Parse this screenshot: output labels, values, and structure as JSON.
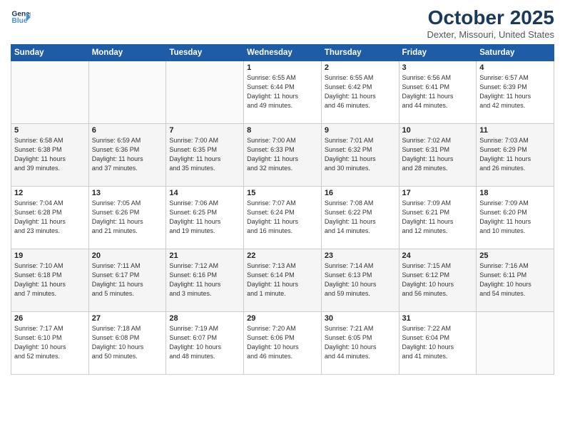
{
  "logo": {
    "line1": "General",
    "line2": "Blue"
  },
  "title": "October 2025",
  "location": "Dexter, Missouri, United States",
  "weekdays": [
    "Sunday",
    "Monday",
    "Tuesday",
    "Wednesday",
    "Thursday",
    "Friday",
    "Saturday"
  ],
  "weeks": [
    [
      {
        "num": "",
        "info": ""
      },
      {
        "num": "",
        "info": ""
      },
      {
        "num": "",
        "info": ""
      },
      {
        "num": "1",
        "info": "Sunrise: 6:55 AM\nSunset: 6:44 PM\nDaylight: 11 hours\nand 49 minutes."
      },
      {
        "num": "2",
        "info": "Sunrise: 6:55 AM\nSunset: 6:42 PM\nDaylight: 11 hours\nand 46 minutes."
      },
      {
        "num": "3",
        "info": "Sunrise: 6:56 AM\nSunset: 6:41 PM\nDaylight: 11 hours\nand 44 minutes."
      },
      {
        "num": "4",
        "info": "Sunrise: 6:57 AM\nSunset: 6:39 PM\nDaylight: 11 hours\nand 42 minutes."
      }
    ],
    [
      {
        "num": "5",
        "info": "Sunrise: 6:58 AM\nSunset: 6:38 PM\nDaylight: 11 hours\nand 39 minutes."
      },
      {
        "num": "6",
        "info": "Sunrise: 6:59 AM\nSunset: 6:36 PM\nDaylight: 11 hours\nand 37 minutes."
      },
      {
        "num": "7",
        "info": "Sunrise: 7:00 AM\nSunset: 6:35 PM\nDaylight: 11 hours\nand 35 minutes."
      },
      {
        "num": "8",
        "info": "Sunrise: 7:00 AM\nSunset: 6:33 PM\nDaylight: 11 hours\nand 32 minutes."
      },
      {
        "num": "9",
        "info": "Sunrise: 7:01 AM\nSunset: 6:32 PM\nDaylight: 11 hours\nand 30 minutes."
      },
      {
        "num": "10",
        "info": "Sunrise: 7:02 AM\nSunset: 6:31 PM\nDaylight: 11 hours\nand 28 minutes."
      },
      {
        "num": "11",
        "info": "Sunrise: 7:03 AM\nSunset: 6:29 PM\nDaylight: 11 hours\nand 26 minutes."
      }
    ],
    [
      {
        "num": "12",
        "info": "Sunrise: 7:04 AM\nSunset: 6:28 PM\nDaylight: 11 hours\nand 23 minutes."
      },
      {
        "num": "13",
        "info": "Sunrise: 7:05 AM\nSunset: 6:26 PM\nDaylight: 11 hours\nand 21 minutes."
      },
      {
        "num": "14",
        "info": "Sunrise: 7:06 AM\nSunset: 6:25 PM\nDaylight: 11 hours\nand 19 minutes."
      },
      {
        "num": "15",
        "info": "Sunrise: 7:07 AM\nSunset: 6:24 PM\nDaylight: 11 hours\nand 16 minutes."
      },
      {
        "num": "16",
        "info": "Sunrise: 7:08 AM\nSunset: 6:22 PM\nDaylight: 11 hours\nand 14 minutes."
      },
      {
        "num": "17",
        "info": "Sunrise: 7:09 AM\nSunset: 6:21 PM\nDaylight: 11 hours\nand 12 minutes."
      },
      {
        "num": "18",
        "info": "Sunrise: 7:09 AM\nSunset: 6:20 PM\nDaylight: 11 hours\nand 10 minutes."
      }
    ],
    [
      {
        "num": "19",
        "info": "Sunrise: 7:10 AM\nSunset: 6:18 PM\nDaylight: 11 hours\nand 7 minutes."
      },
      {
        "num": "20",
        "info": "Sunrise: 7:11 AM\nSunset: 6:17 PM\nDaylight: 11 hours\nand 5 minutes."
      },
      {
        "num": "21",
        "info": "Sunrise: 7:12 AM\nSunset: 6:16 PM\nDaylight: 11 hours\nand 3 minutes."
      },
      {
        "num": "22",
        "info": "Sunrise: 7:13 AM\nSunset: 6:14 PM\nDaylight: 11 hours\nand 1 minute."
      },
      {
        "num": "23",
        "info": "Sunrise: 7:14 AM\nSunset: 6:13 PM\nDaylight: 10 hours\nand 59 minutes."
      },
      {
        "num": "24",
        "info": "Sunrise: 7:15 AM\nSunset: 6:12 PM\nDaylight: 10 hours\nand 56 minutes."
      },
      {
        "num": "25",
        "info": "Sunrise: 7:16 AM\nSunset: 6:11 PM\nDaylight: 10 hours\nand 54 minutes."
      }
    ],
    [
      {
        "num": "26",
        "info": "Sunrise: 7:17 AM\nSunset: 6:10 PM\nDaylight: 10 hours\nand 52 minutes."
      },
      {
        "num": "27",
        "info": "Sunrise: 7:18 AM\nSunset: 6:08 PM\nDaylight: 10 hours\nand 50 minutes."
      },
      {
        "num": "28",
        "info": "Sunrise: 7:19 AM\nSunset: 6:07 PM\nDaylight: 10 hours\nand 48 minutes."
      },
      {
        "num": "29",
        "info": "Sunrise: 7:20 AM\nSunset: 6:06 PM\nDaylight: 10 hours\nand 46 minutes."
      },
      {
        "num": "30",
        "info": "Sunrise: 7:21 AM\nSunset: 6:05 PM\nDaylight: 10 hours\nand 44 minutes."
      },
      {
        "num": "31",
        "info": "Sunrise: 7:22 AM\nSunset: 6:04 PM\nDaylight: 10 hours\nand 41 minutes."
      },
      {
        "num": "",
        "info": ""
      }
    ]
  ]
}
